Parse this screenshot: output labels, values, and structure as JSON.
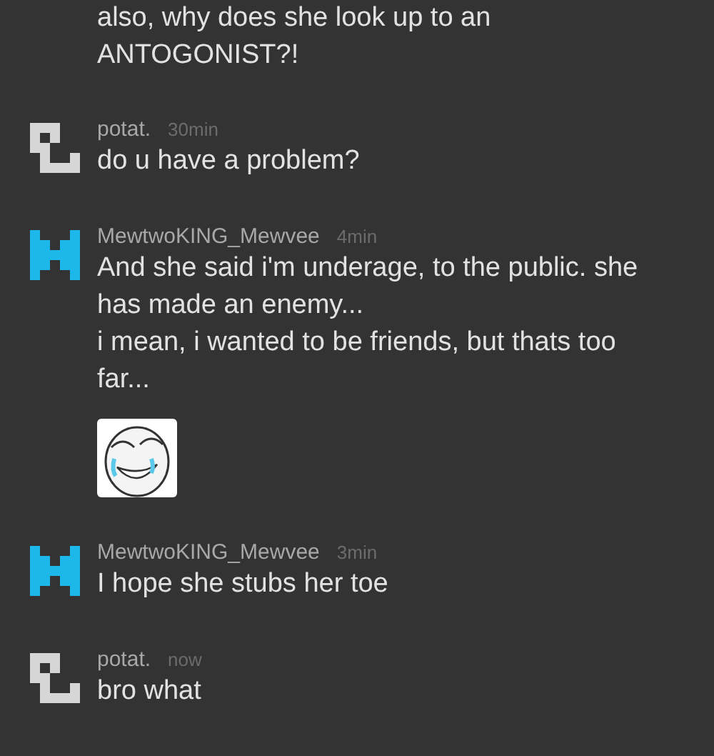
{
  "messages": [
    {
      "lines": [
        "also, why does she look up to an",
        "ANTOGONIST?!"
      ]
    },
    {
      "author": "potat.",
      "time": "30min",
      "avatar": {
        "kind": "hook",
        "color": "#d6d6d6"
      },
      "lines": [
        "do u have a problem?"
      ]
    },
    {
      "author": "MewtwoKING_Mewvee",
      "time": "4min",
      "avatar": {
        "kind": "bars",
        "color": "#1cb8ea"
      },
      "lines": [
        "And she said i'm underage, to the public. she has made an enemy...",
        "i mean, i wanted to be friends, but thats too far..."
      ]
    },
    {
      "author": "MewtwoKING_Mewvee",
      "time": "3min",
      "avatar": {
        "kind": "bars",
        "color": "#1cb8ea"
      },
      "lines": [
        "I hope she stubs her toe"
      ]
    },
    {
      "author": "potat.",
      "time": "now",
      "avatar": {
        "kind": "hook",
        "color": "#d6d6d6"
      },
      "lines": [
        "bro what"
      ]
    }
  ]
}
